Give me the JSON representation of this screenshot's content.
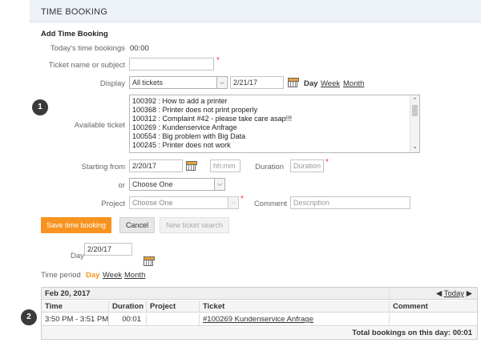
{
  "header": {
    "title": "TIME BOOKING"
  },
  "form": {
    "section_title": "Add Time Booking",
    "todays_label": "Today's time bookings",
    "todays_value": "00:00",
    "ticket_label": "Ticket name or subject",
    "ticket_value": "",
    "display_label": "Display",
    "display_selected": "All tickets",
    "display_date": "2/21/17",
    "view_day": "Day",
    "view_week": "Week",
    "view_month": "Month",
    "available_label": "Available ticket",
    "tickets": [
      "100392 : How to add a printer",
      "100368 : Printer does not print properly",
      "100312 : Complaint #42 - please take care asap!!!",
      "100269 : Kundenservice Anfrage",
      "100554 : Big problem with Big Data",
      "100245 : Printer does not work"
    ],
    "starting_label": "Starting from",
    "starting_date": "2/20/17",
    "time_placeholder": "hh:mm",
    "duration_label": "Duration",
    "duration_placeholder": "Duration",
    "or_label": "or",
    "or_selected": "Choose One",
    "project_label": "Project",
    "project_selected": "Choose One",
    "comment_label": "Comment",
    "comment_placeholder": "Description",
    "required_mark": "*"
  },
  "buttons": {
    "save": "Save time booking",
    "cancel": "Cancel",
    "new_search": "New ticket search"
  },
  "filter": {
    "day_label": "Day",
    "day_value": "2/20/17",
    "period_label": "Time period",
    "period_day": "Day",
    "period_week": "Week",
    "period_month": "Month"
  },
  "bookings": {
    "date_header": "Feb 20, 2017",
    "today_link": "Today",
    "prev_icon": "caret-left-icon",
    "next_icon": "caret-right-icon",
    "columns": [
      "Time",
      "Duration",
      "Project",
      "Ticket",
      "Comment"
    ],
    "rows": [
      {
        "time": "3:50 PM - 3:51 PM",
        "duration": "00:01",
        "project": "",
        "ticket": "#100269 Kundenservice Anfrage",
        "comment": ""
      }
    ],
    "total_label": "Total bookings on this day: 00:01"
  },
  "markers": {
    "one": "1",
    "two": "2"
  },
  "colors": {
    "accent": "#f7931e",
    "header_bg": "#edf2f8",
    "required": "#e33333"
  }
}
